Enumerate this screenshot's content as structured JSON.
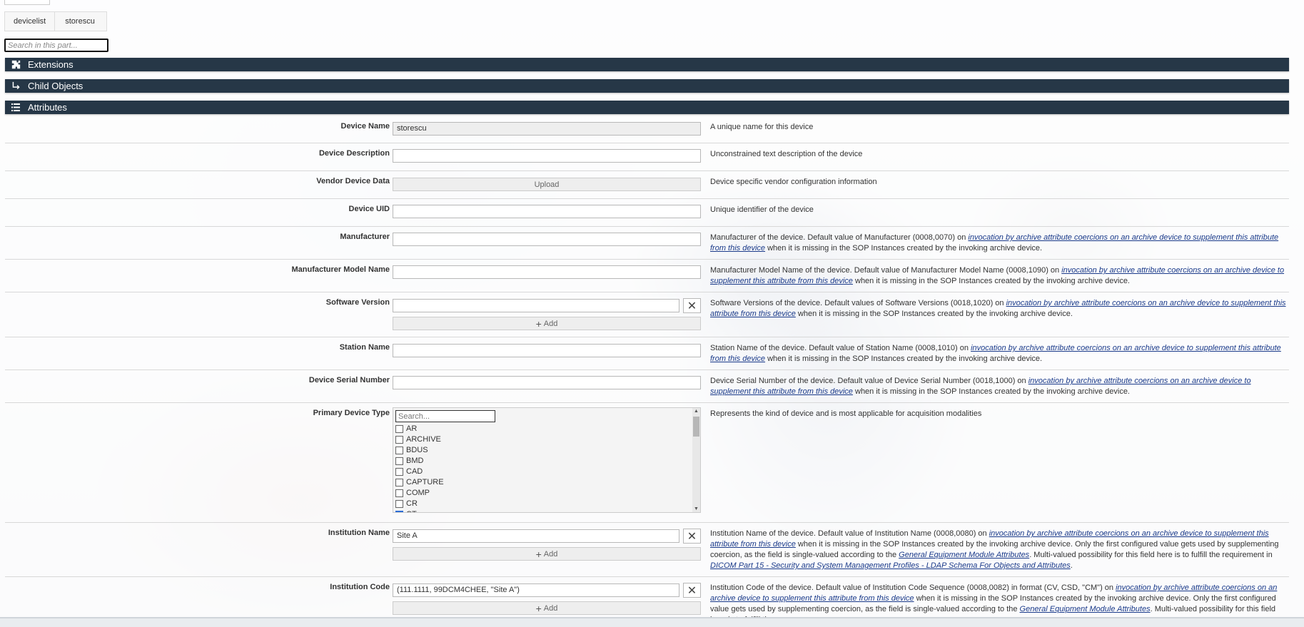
{
  "breadcrumb": {
    "items": [
      "devicelist",
      "storescu"
    ]
  },
  "search": {
    "placeholder": "Search in this part..."
  },
  "sections": {
    "extensions": "Extensions",
    "child_objects": "Child Objects",
    "attributes": "Attributes"
  },
  "icons": {
    "extensions": "puzzle-icon",
    "child_objects": "child-arrow-icon",
    "attributes": "list-icon"
  },
  "colors": {
    "section_bar": "#263747",
    "link": "#1a3a8a",
    "checkbox_checked": "#2c6dd5"
  },
  "common": {
    "add": "Add",
    "upload": "Upload",
    "desc_link": "invocation by archive attribute coercions on an archive device to supplement this attribute from this device",
    "desc_tail": " when it is missing in the SOP Instances created by the invoking archive device."
  },
  "attributes": {
    "device_name": {
      "label": "Device Name",
      "value": "storescu",
      "desc": "A unique name for this device"
    },
    "device_description": {
      "label": "Device Description",
      "value": "",
      "desc": "Unconstrained text description of the device"
    },
    "vendor_device_data": {
      "label": "Vendor Device Data",
      "desc": "Device specific vendor configuration information"
    },
    "device_uid": {
      "label": "Device UID",
      "value": "",
      "desc": "Unique identifier of the device"
    },
    "manufacturer": {
      "label": "Manufacturer",
      "value": "",
      "desc_pre": "Manufacturer of the device. Default value of Manufacturer (0008,0070) on "
    },
    "manufacturer_model_name": {
      "label": "Manufacturer Model Name",
      "value": "",
      "desc_pre": "Manufacturer Model Name of the device. Default value of Manufacturer Model Name (0008,1090) on "
    },
    "software_version": {
      "label": "Software Version",
      "value": "",
      "desc_pre": "Software Versions of the device. Default values of Software Versions (0018,1020) on "
    },
    "station_name": {
      "label": "Station Name",
      "value": "",
      "desc_pre": "Station Name of the device. Default value of Station Name (0008,1010) on "
    },
    "device_serial_number": {
      "label": "Device Serial Number",
      "value": "",
      "desc_pre": "Device Serial Number of the device. Default value of Device Serial Number (0018,1000) on "
    },
    "primary_device_type": {
      "label": "Primary Device Type",
      "search_placeholder": "Search...",
      "options": [
        "AR",
        "ARCHIVE",
        "BDUS",
        "BMD",
        "CAD",
        "CAPTURE",
        "COMP",
        "CR",
        "CT"
      ],
      "checked": [
        "CT"
      ],
      "desc": "Represents the kind of device and is most applicable for acquisition modalities"
    },
    "institution_name": {
      "label": "Institution Name",
      "value": "Site A",
      "desc_pre": "Institution Name of the device. Default value of Institution Name (0008,0080) on ",
      "desc_mid": " when it is missing in the SOP Instances created by the invoking archive device. Only the first configured value gets used by supplementing coercion, as the field is single-valued according to the ",
      "link2": "General Equipment Module Attributes",
      "desc_mid2": ". Multi-valued possibility for this field here is to fulfill the requirement in ",
      "link3": "DICOM Part 15 - Security and System Management Profiles - LDAP Schema For Objects and Attributes",
      "desc_end": "."
    },
    "institution_code": {
      "label": "Institution Code",
      "value": "(111.1111, 99DCM4CHEE, \"Site A\")",
      "desc_pre": "Institution Code of the device. Default value of Institution Code Sequence (0008,0082) in format (CV, CSD, \"CM\") on ",
      "desc_mid": " when it is missing in the SOP Instances created by the invoking archive device. Only the first configured value gets used by supplementing coercion, as the field is single-valued according to the ",
      "link2": "General Equipment Module Attributes",
      "desc_mid2": ". Multi-valued possibility for this field here is to fulfill the"
    }
  }
}
